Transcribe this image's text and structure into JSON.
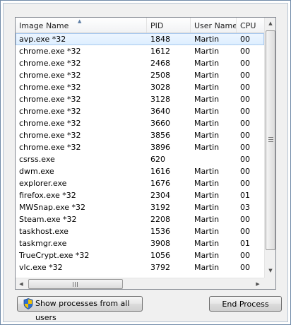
{
  "columns": [
    "Image Name",
    "PID",
    "User Name",
    "CPU"
  ],
  "sort_indicator": "▲",
  "processes": [
    {
      "name": "avp.exe *32",
      "pid": "1848",
      "user": "Martin",
      "cpu": "00",
      "selected": true
    },
    {
      "name": "chrome.exe *32",
      "pid": "1612",
      "user": "Martin",
      "cpu": "00"
    },
    {
      "name": "chrome.exe *32",
      "pid": "2468",
      "user": "Martin",
      "cpu": "00"
    },
    {
      "name": "chrome.exe *32",
      "pid": "2508",
      "user": "Martin",
      "cpu": "00"
    },
    {
      "name": "chrome.exe *32",
      "pid": "3028",
      "user": "Martin",
      "cpu": "00"
    },
    {
      "name": "chrome.exe *32",
      "pid": "3128",
      "user": "Martin",
      "cpu": "00"
    },
    {
      "name": "chrome.exe *32",
      "pid": "3640",
      "user": "Martin",
      "cpu": "00"
    },
    {
      "name": "chrome.exe *32",
      "pid": "3660",
      "user": "Martin",
      "cpu": "00"
    },
    {
      "name": "chrome.exe *32",
      "pid": "3856",
      "user": "Martin",
      "cpu": "00"
    },
    {
      "name": "chrome.exe *32",
      "pid": "3896",
      "user": "Martin",
      "cpu": "00"
    },
    {
      "name": "csrss.exe",
      "pid": "620",
      "user": "",
      "cpu": "00"
    },
    {
      "name": "dwm.exe",
      "pid": "1616",
      "user": "Martin",
      "cpu": "00"
    },
    {
      "name": "explorer.exe",
      "pid": "1676",
      "user": "Martin",
      "cpu": "00"
    },
    {
      "name": "firefox.exe *32",
      "pid": "2304",
      "user": "Martin",
      "cpu": "01"
    },
    {
      "name": "MWSnap.exe *32",
      "pid": "3192",
      "user": "Martin",
      "cpu": "03"
    },
    {
      "name": "Steam.exe *32",
      "pid": "2208",
      "user": "Martin",
      "cpu": "00"
    },
    {
      "name": "taskhost.exe",
      "pid": "1536",
      "user": "Martin",
      "cpu": "00"
    },
    {
      "name": "taskmgr.exe",
      "pid": "3908",
      "user": "Martin",
      "cpu": "01"
    },
    {
      "name": "TrueCrypt.exe *32",
      "pid": "1056",
      "user": "Martin",
      "cpu": "00"
    },
    {
      "name": "vlc.exe *32",
      "pid": "3792",
      "user": "Martin",
      "cpu": "00"
    }
  ],
  "scrollbar": {
    "up_arrow": "▲",
    "down_arrow": "▼",
    "left_arrow": "◀",
    "right_arrow": "▶"
  },
  "buttons": {
    "show_all_label": "Show processes from all users",
    "end_process_label": "End Process"
  },
  "colors": {
    "selection": "#dceeff",
    "selection_border": "#a8c9ef",
    "shield_blue": "#2f6fd0",
    "shield_yellow": "#f2c200"
  },
  "icons": {
    "shield": "uac-shield-icon"
  }
}
